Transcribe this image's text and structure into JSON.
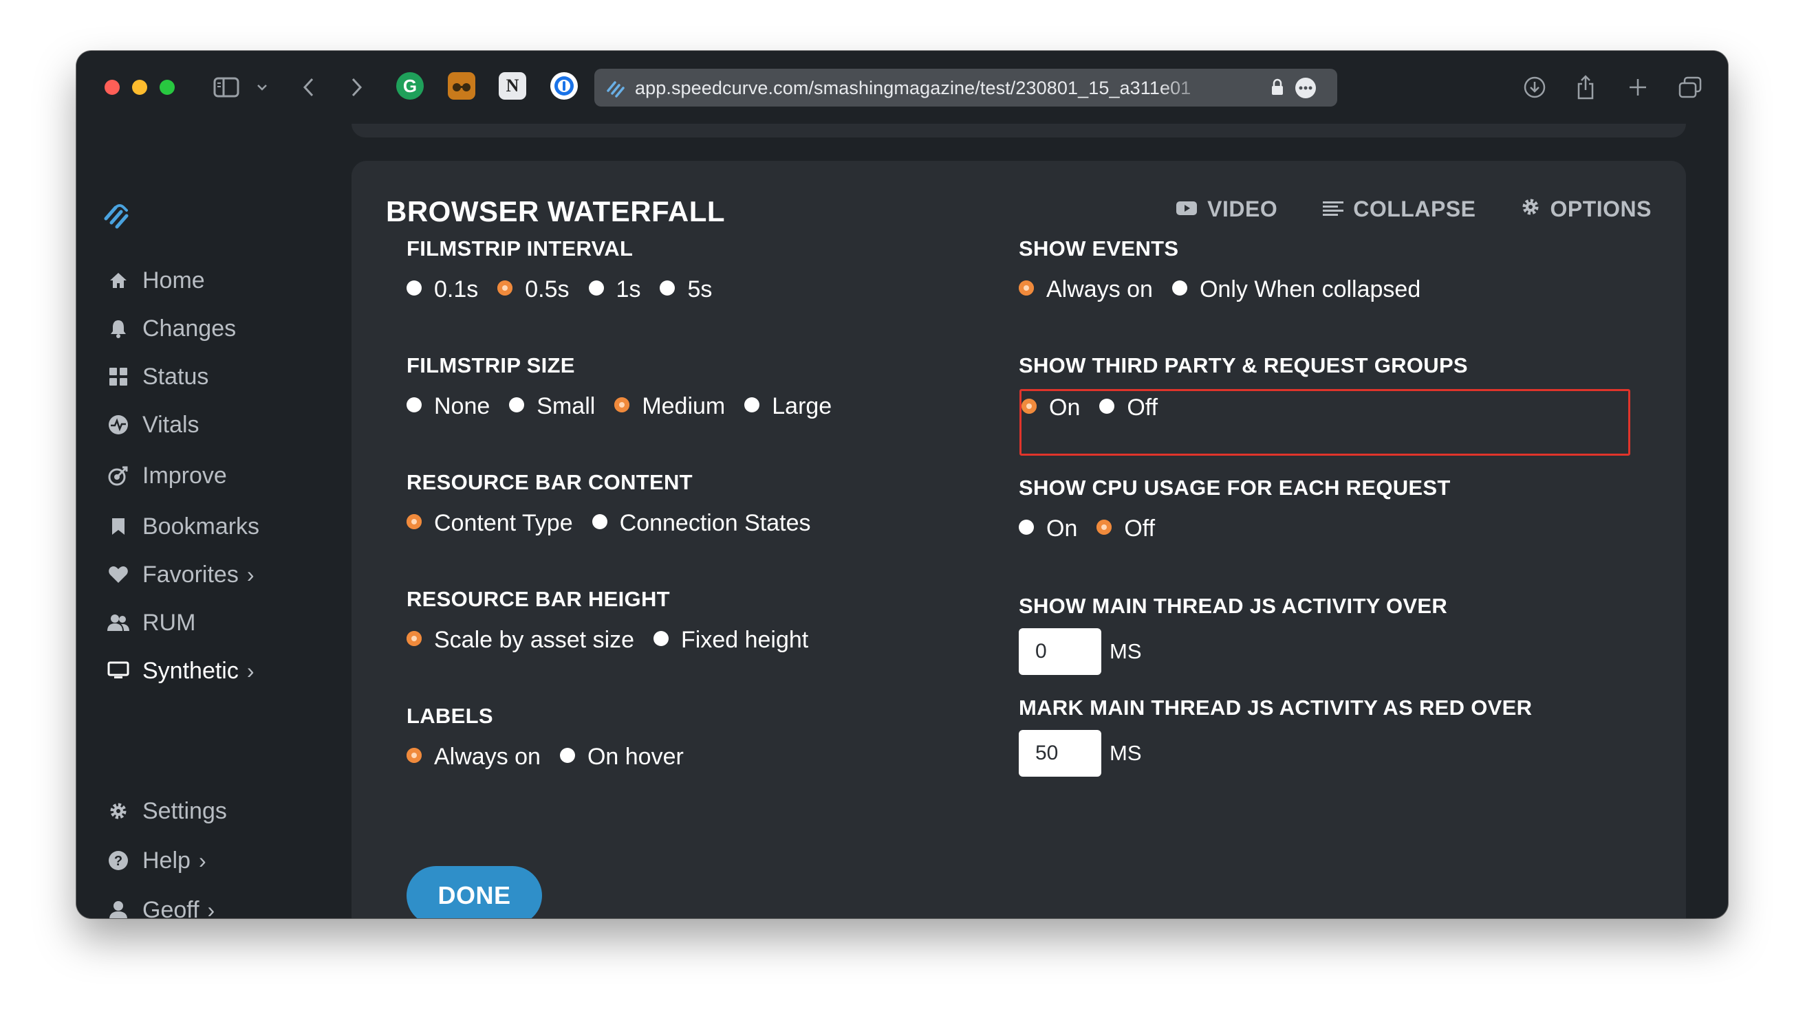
{
  "browser": {
    "url": "app.speedcurve.com/smashingmagazine/test/230801_15_a311e01"
  },
  "sidebar": {
    "items": [
      {
        "label": "Home",
        "icon": "home-icon"
      },
      {
        "label": "Changes",
        "icon": "bell-icon"
      },
      {
        "label": "Status",
        "icon": "grid-icon"
      },
      {
        "label": "Vitals",
        "icon": "pulse-icon"
      },
      {
        "label": "Improve",
        "icon": "target-icon"
      },
      {
        "label": "Bookmarks",
        "icon": "bookmark-icon"
      },
      {
        "label": "Favorites",
        "icon": "heart-icon",
        "chevron": "›"
      },
      {
        "label": "RUM",
        "icon": "users-icon"
      },
      {
        "label": "Synthetic",
        "icon": "monitor-icon",
        "chevron": "›",
        "active": true
      }
    ],
    "bottom_items": [
      {
        "label": "Settings",
        "icon": "gear-icon"
      },
      {
        "label": "Help",
        "icon": "help-icon",
        "chevron": "›"
      },
      {
        "label": "Geoff",
        "icon": "user-icon",
        "chevron": "›"
      }
    ]
  },
  "panel": {
    "title": "BROWSER WATERFALL",
    "actions": {
      "video": "VIDEO",
      "collapse": "COLLAPSE",
      "options": "OPTIONS"
    },
    "filmstrip_interval": {
      "label": "FILMSTRIP INTERVAL",
      "options": [
        "0.1s",
        "0.5s",
        "1s",
        "5s"
      ],
      "selected": "0.5s"
    },
    "filmstrip_size": {
      "label": "FILMSTRIP SIZE",
      "options": [
        "None",
        "Small",
        "Medium",
        "Large"
      ],
      "selected": "Medium"
    },
    "resource_bar_content": {
      "label": "RESOURCE BAR CONTENT",
      "options": [
        "Content Type",
        "Connection States"
      ],
      "selected": "Content Type"
    },
    "resource_bar_height": {
      "label": "RESOURCE BAR HEIGHT",
      "options": [
        "Scale by asset size",
        "Fixed height"
      ],
      "selected": "Scale by asset size"
    },
    "labels": {
      "label": "LABELS",
      "options": [
        "Always on",
        "On hover"
      ],
      "selected": "Always on"
    },
    "show_events": {
      "label": "SHOW EVENTS",
      "options": [
        "Always on",
        "Only When collapsed"
      ],
      "selected": "Always on"
    },
    "third_party": {
      "label": "SHOW THIRD PARTY & REQUEST GROUPS",
      "options": [
        "On",
        "Off"
      ],
      "selected": "On"
    },
    "cpu_usage": {
      "label": "SHOW CPU USAGE FOR EACH REQUEST",
      "options": [
        "On",
        "Off"
      ],
      "selected": "Off"
    },
    "main_thread": {
      "label": "SHOW MAIN THREAD JS ACTIVITY OVER",
      "value": "0",
      "unit": "MS"
    },
    "mark_red": {
      "label": "MARK MAIN THREAD JS ACTIVITY AS RED OVER",
      "value": "50",
      "unit": "MS"
    },
    "done_label": "DONE"
  },
  "colors": {
    "accent_orange": "#f08a3c",
    "done_blue": "#2f8fc9",
    "highlight_red": "#e0342b",
    "panel_bg": "#2a2e33",
    "sidebar_bg": "#1e2226"
  }
}
